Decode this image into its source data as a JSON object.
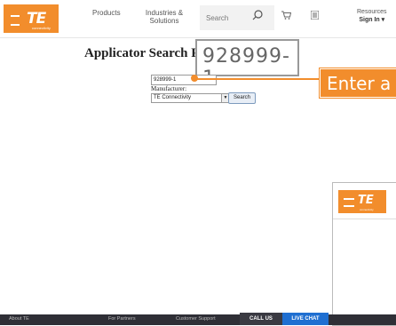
{
  "header": {
    "logo_text": "TE",
    "logo_subtext": "connectivity",
    "nav_products": "Products",
    "nav_industries_line1": "Industries &",
    "nav_industries_line2": "Solutions",
    "search_placeholder": "Search",
    "resources": "Resources",
    "sign_in": "Sign In ▾"
  },
  "main": {
    "title": "Applicator Search P",
    "part_number_value": "928999-1",
    "manufacturer_label": "Manufacturer:",
    "manufacturer_selected": "TE Connectivity",
    "search_button": "Search"
  },
  "annotation": {
    "zoom_text": "928999-1",
    "callout_text": "Enter a"
  },
  "overlay": {
    "logo_text": "TE",
    "logo_subtext": "connectivity"
  },
  "footer": {
    "about": "About TE",
    "partners": "For Partners",
    "support": "Customer Support",
    "call_us": "CALL US",
    "live_chat": "LIVE CHAT"
  },
  "colors": {
    "brand_orange": "#f28d2c",
    "footer_dark": "#2f2f36",
    "live_chat_blue": "#1f6fd1"
  }
}
